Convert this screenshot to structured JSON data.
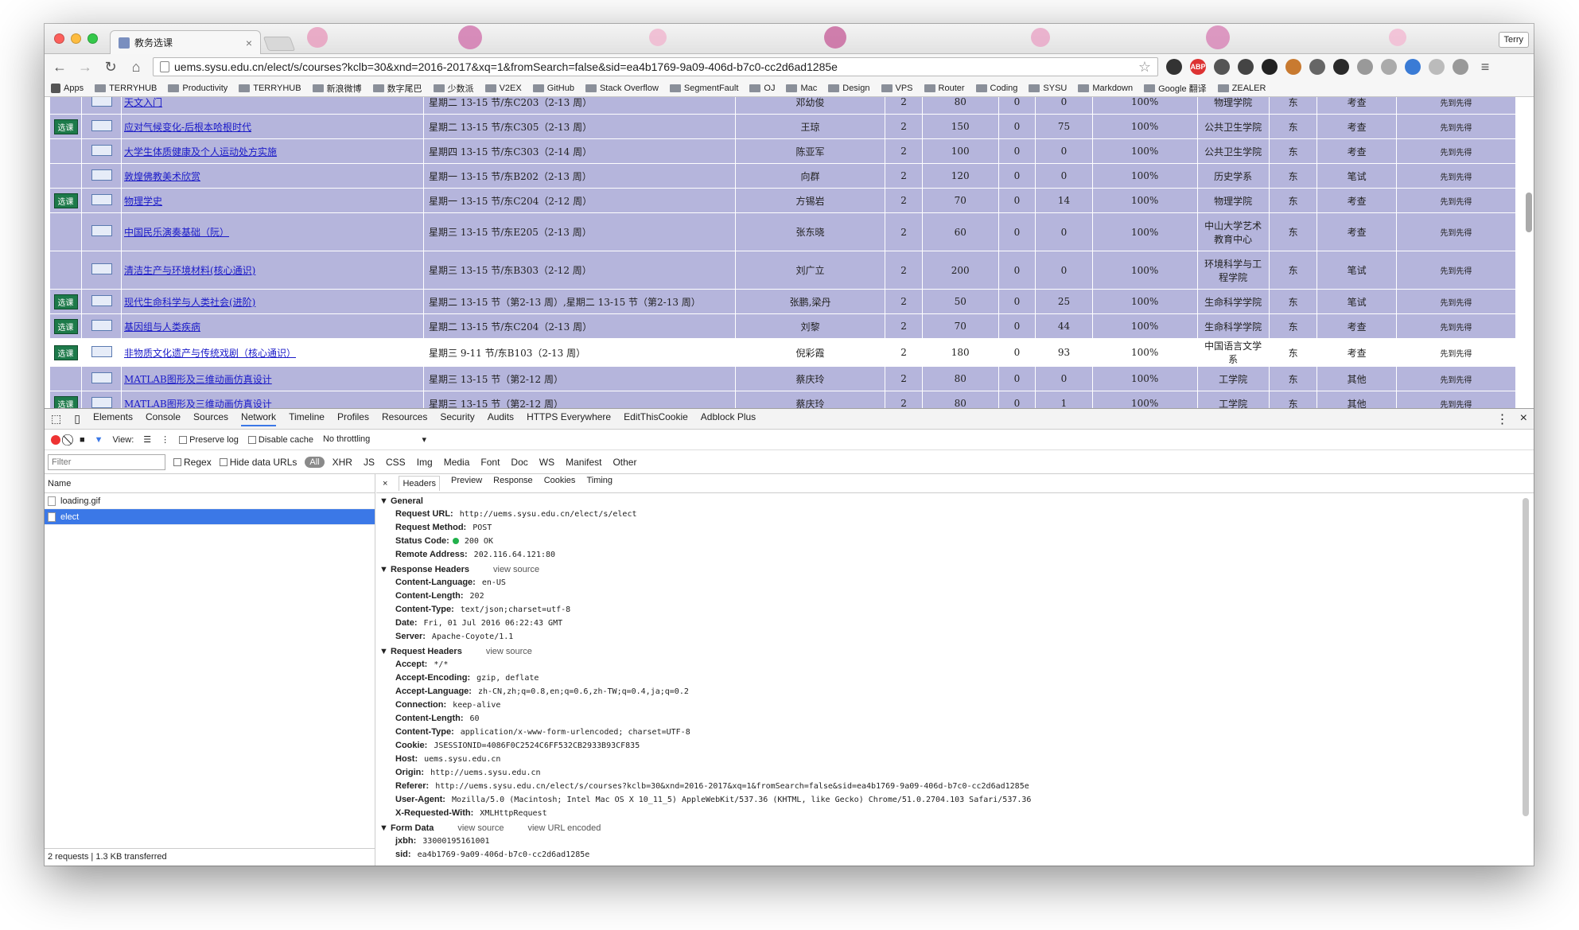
{
  "browser": {
    "tab_title": "教务选课",
    "profile_name": "Terry",
    "url": "uems.sysu.edu.cn/elect/s/courses?kclb=30&xnd=2016-2017&xq=1&fromSearch=false&sid=ea4b1769-9a09-406d-b7c0-cc2d6ad1285e",
    "bookmarks": [
      "Apps",
      "TERRYHUB",
      "Productivity",
      "TERRYHUB",
      "新浪微博",
      "数字尾巴",
      "少数派",
      "V2EX",
      "GitHub",
      "Stack Overflow",
      "SegmentFault",
      "OJ",
      "Mac",
      "Design",
      "VPS",
      "Router",
      "Coding",
      "SYSU",
      "Markdown",
      "Google 翻译",
      "ZEALER"
    ]
  },
  "courses": [
    {
      "action": "",
      "name": "天文入门",
      "time": "星期二 13-15 节/东C203（2-13 周）",
      "teacher": "邓幼俊",
      "credit": "2",
      "cap": "80",
      "c1": "0",
      "c2": "0",
      "rate": "100%",
      "dept": "物理学院",
      "campus": "东",
      "exam": "考查",
      "rule": "先到先得",
      "tall": false,
      "white": false
    },
    {
      "action": "选课",
      "name": "应对气候变化-后根本哈根时代",
      "time": "星期二 13-15 节/东C305（2-13 周）",
      "teacher": "王琼",
      "credit": "2",
      "cap": "150",
      "c1": "0",
      "c2": "75",
      "rate": "100%",
      "dept": "公共卫生学院",
      "campus": "东",
      "exam": "考查",
      "rule": "先到先得",
      "tall": false,
      "white": false
    },
    {
      "action": "",
      "name": "大学生体质健康及个人运动处方实施",
      "time": "星期四 13-15 节/东C303（2-14 周）",
      "teacher": "陈亚军",
      "credit": "2",
      "cap": "100",
      "c1": "0",
      "c2": "0",
      "rate": "100%",
      "dept": "公共卫生学院",
      "campus": "东",
      "exam": "考查",
      "rule": "先到先得",
      "tall": false,
      "white": false
    },
    {
      "action": "",
      "name": "敦煌佛教美术欣赏",
      "time": "星期一 13-15 节/东B202（2-13 周）",
      "teacher": "向群",
      "credit": "2",
      "cap": "120",
      "c1": "0",
      "c2": "0",
      "rate": "100%",
      "dept": "历史学系",
      "campus": "东",
      "exam": "笔试",
      "rule": "先到先得",
      "tall": false,
      "white": false
    },
    {
      "action": "选课",
      "name": "物理学史",
      "time": "星期一 13-15 节/东C204（2-12 周）",
      "teacher": "方锡岩",
      "credit": "2",
      "cap": "70",
      "c1": "0",
      "c2": "14",
      "rate": "100%",
      "dept": "物理学院",
      "campus": "东",
      "exam": "考查",
      "rule": "先到先得",
      "tall": false,
      "white": false
    },
    {
      "action": "",
      "name": "中国民乐演奏基础（阮）",
      "time": "星期三 13-15 节/东E205（2-13 周）",
      "teacher": "张东晓",
      "credit": "2",
      "cap": "60",
      "c1": "0",
      "c2": "0",
      "rate": "100%",
      "dept": "中山大学艺术教育中心",
      "campus": "东",
      "exam": "考查",
      "rule": "先到先得",
      "tall": true,
      "white": false
    },
    {
      "action": "",
      "name": "清洁生产与环境材料(核心通识)",
      "time": "星期三 13-15 节/东B303（2-12 周）",
      "teacher": "刘广立",
      "credit": "2",
      "cap": "200",
      "c1": "0",
      "c2": "0",
      "rate": "100%",
      "dept": "环境科学与工程学院",
      "campus": "东",
      "exam": "笔试",
      "rule": "先到先得",
      "tall": true,
      "white": false
    },
    {
      "action": "选课",
      "name": "现代生命科学与人类社会(进阶)",
      "time": "星期二 13-15 节（第2-13 周）,星期二 13-15 节（第2-13 周）",
      "teacher": "张鹏,梁丹",
      "credit": "2",
      "cap": "50",
      "c1": "0",
      "c2": "25",
      "rate": "100%",
      "dept": "生命科学学院",
      "campus": "东",
      "exam": "笔试",
      "rule": "先到先得",
      "tall": false,
      "white": false
    },
    {
      "action": "选课",
      "name": "基因组与人类疾病",
      "time": "星期二 13-15 节/东C204（2-13 周）",
      "teacher": "刘黎",
      "credit": "2",
      "cap": "70",
      "c1": "0",
      "c2": "44",
      "rate": "100%",
      "dept": "生命科学学院",
      "campus": "东",
      "exam": "考查",
      "rule": "先到先得",
      "tall": false,
      "white": false
    },
    {
      "action": "选课",
      "name": "非物质文化遗产与传统戏剧（核心通识）",
      "time": "星期三 9-11 节/东B103（2-13 周）",
      "teacher": "倪彩霞",
      "credit": "2",
      "cap": "180",
      "c1": "0",
      "c2": "93",
      "rate": "100%",
      "dept": "中国语言文学系",
      "campus": "东",
      "exam": "考查",
      "rule": "先到先得",
      "tall": false,
      "white": true
    },
    {
      "action": "",
      "name": "MATLAB图形及三维动画仿真设计",
      "time": "星期三 13-15 节（第2-12 周）",
      "teacher": "蔡庆玲",
      "credit": "2",
      "cap": "80",
      "c1": "0",
      "c2": "0",
      "rate": "100%",
      "dept": "工学院",
      "campus": "东",
      "exam": "其他",
      "rule": "先到先得",
      "tall": false,
      "white": false
    },
    {
      "action": "选课",
      "name": "MATLAB图形及三维动画仿真设计",
      "time": "星期三 13-15 节（第2-12 周）",
      "teacher": "蔡庆玲",
      "credit": "2",
      "cap": "80",
      "c1": "0",
      "c2": "1",
      "rate": "100%",
      "dept": "工学院",
      "campus": "东",
      "exam": "其他",
      "rule": "先到先得",
      "tall": false,
      "white": false
    }
  ],
  "devtools": {
    "tabs": [
      "Elements",
      "Console",
      "Sources",
      "Network",
      "Timeline",
      "Profiles",
      "Resources",
      "Security",
      "Audits",
      "HTTPS Everywhere",
      "EditThisCookie",
      "Adblock Plus"
    ],
    "active_tab": "Network",
    "net": {
      "view": "View:",
      "preserve": "Preserve log",
      "disable_cache": "Disable cache",
      "throttle": "No throttling"
    },
    "filter": {
      "placeholder": "Filter",
      "regex": "Regex",
      "hide": "Hide data URLs",
      "all": "All",
      "types": [
        "XHR",
        "JS",
        "CSS",
        "Img",
        "Media",
        "Font",
        "Doc",
        "WS",
        "Manifest",
        "Other"
      ]
    },
    "list_header": "Name",
    "requests": [
      "loading.gif",
      "elect"
    ],
    "status": "2 requests  |  1.3 KB transferred",
    "detail_tabs": [
      "Headers",
      "Preview",
      "Response",
      "Cookies",
      "Timing"
    ],
    "view_source": "view source",
    "view_url_encoded": "view URL encoded",
    "sections": [
      {
        "title": "General",
        "items": [
          [
            "Request URL:",
            "http://uems.sysu.edu.cn/elect/s/elect"
          ],
          [
            "Request Method:",
            "POST"
          ],
          [
            "Status Code:",
            "200 OK"
          ],
          [
            "Remote Address:",
            "202.116.64.121:80"
          ]
        ]
      },
      {
        "title": "Response Headers",
        "items": [
          [
            "Content-Language:",
            "en-US"
          ],
          [
            "Content-Length:",
            "202"
          ],
          [
            "Content-Type:",
            "text/json;charset=utf-8"
          ],
          [
            "Date:",
            "Fri, 01 Jul 2016 06:22:43 GMT"
          ],
          [
            "Server:",
            "Apache-Coyote/1.1"
          ]
        ]
      },
      {
        "title": "Request Headers",
        "items": [
          [
            "Accept:",
            "*/*"
          ],
          [
            "Accept-Encoding:",
            "gzip, deflate"
          ],
          [
            "Accept-Language:",
            "zh-CN,zh;q=0.8,en;q=0.6,zh-TW;q=0.4,ja;q=0.2"
          ],
          [
            "Connection:",
            "keep-alive"
          ],
          [
            "Content-Length:",
            "60"
          ],
          [
            "Content-Type:",
            "application/x-www-form-urlencoded; charset=UTF-8"
          ],
          [
            "Cookie:",
            "JSESSIONID=4086F0C2524C6FF532CB2933B93CF835"
          ],
          [
            "Host:",
            "uems.sysu.edu.cn"
          ],
          [
            "Origin:",
            "http://uems.sysu.edu.cn"
          ],
          [
            "Referer:",
            "http://uems.sysu.edu.cn/elect/s/courses?kclb=30&xnd=2016-2017&xq=1&fromSearch=false&sid=ea4b1769-9a09-406d-b7c0-cc2d6ad1285e"
          ],
          [
            "User-Agent:",
            "Mozilla/5.0 (Macintosh; Intel Mac OS X 10_11_5) AppleWebKit/537.36 (KHTML, like Gecko) Chrome/51.0.2704.103 Safari/537.36"
          ],
          [
            "X-Requested-With:",
            "XMLHttpRequest"
          ]
        ]
      },
      {
        "title": "Form Data",
        "items": [
          [
            "jxbh:",
            "33000195161001"
          ],
          [
            "sid:",
            "ea4b1769-9a09-406d-b7c0-cc2d6ad1285e"
          ]
        ]
      }
    ]
  }
}
